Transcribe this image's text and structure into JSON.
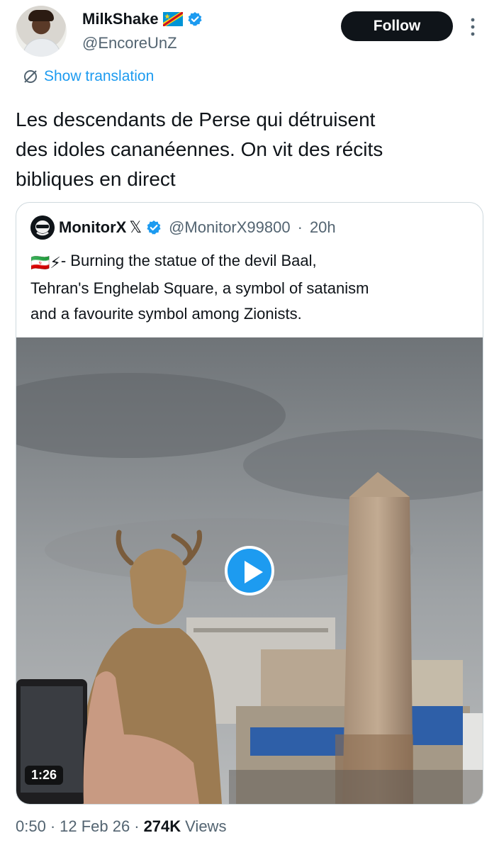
{
  "author": {
    "display_name": "MilkShake",
    "handle": "@EncoreUnZ",
    "flag_icon": "dr-congo-flag-icon",
    "verified_icon": "verified-badge-icon",
    "follow_label": "Follow"
  },
  "translation": {
    "label": "Show translation",
    "icon": "translate-icon"
  },
  "tweet": {
    "text": "Les descendants de Perse qui détruisent\ndes idoles cananéennes. On vit des récits\nbibliques en direct"
  },
  "quoted": {
    "display_name": "MonitorX",
    "x_mark": "𝕏",
    "handle": "@MonitorX99800",
    "separator": "·",
    "time": "20h",
    "emoji": "🇮🇷⚡",
    "text": "- Burning the statue of the devil Baal,\nTehran's Enghelab Square, a symbol of satanism\nand a favourite symbol among Zionists.",
    "video": {
      "duration": "1:26",
      "play_icon": "play-icon"
    }
  },
  "meta": {
    "time": "0:50",
    "sep1": "·",
    "date": "12 Feb 26",
    "sep2": "·",
    "views_count": "274K",
    "views_label": "Views"
  },
  "colors": {
    "accent": "#1d9bf0",
    "text": "#0f1419",
    "muted": "#536471",
    "border": "#cfd9de"
  }
}
